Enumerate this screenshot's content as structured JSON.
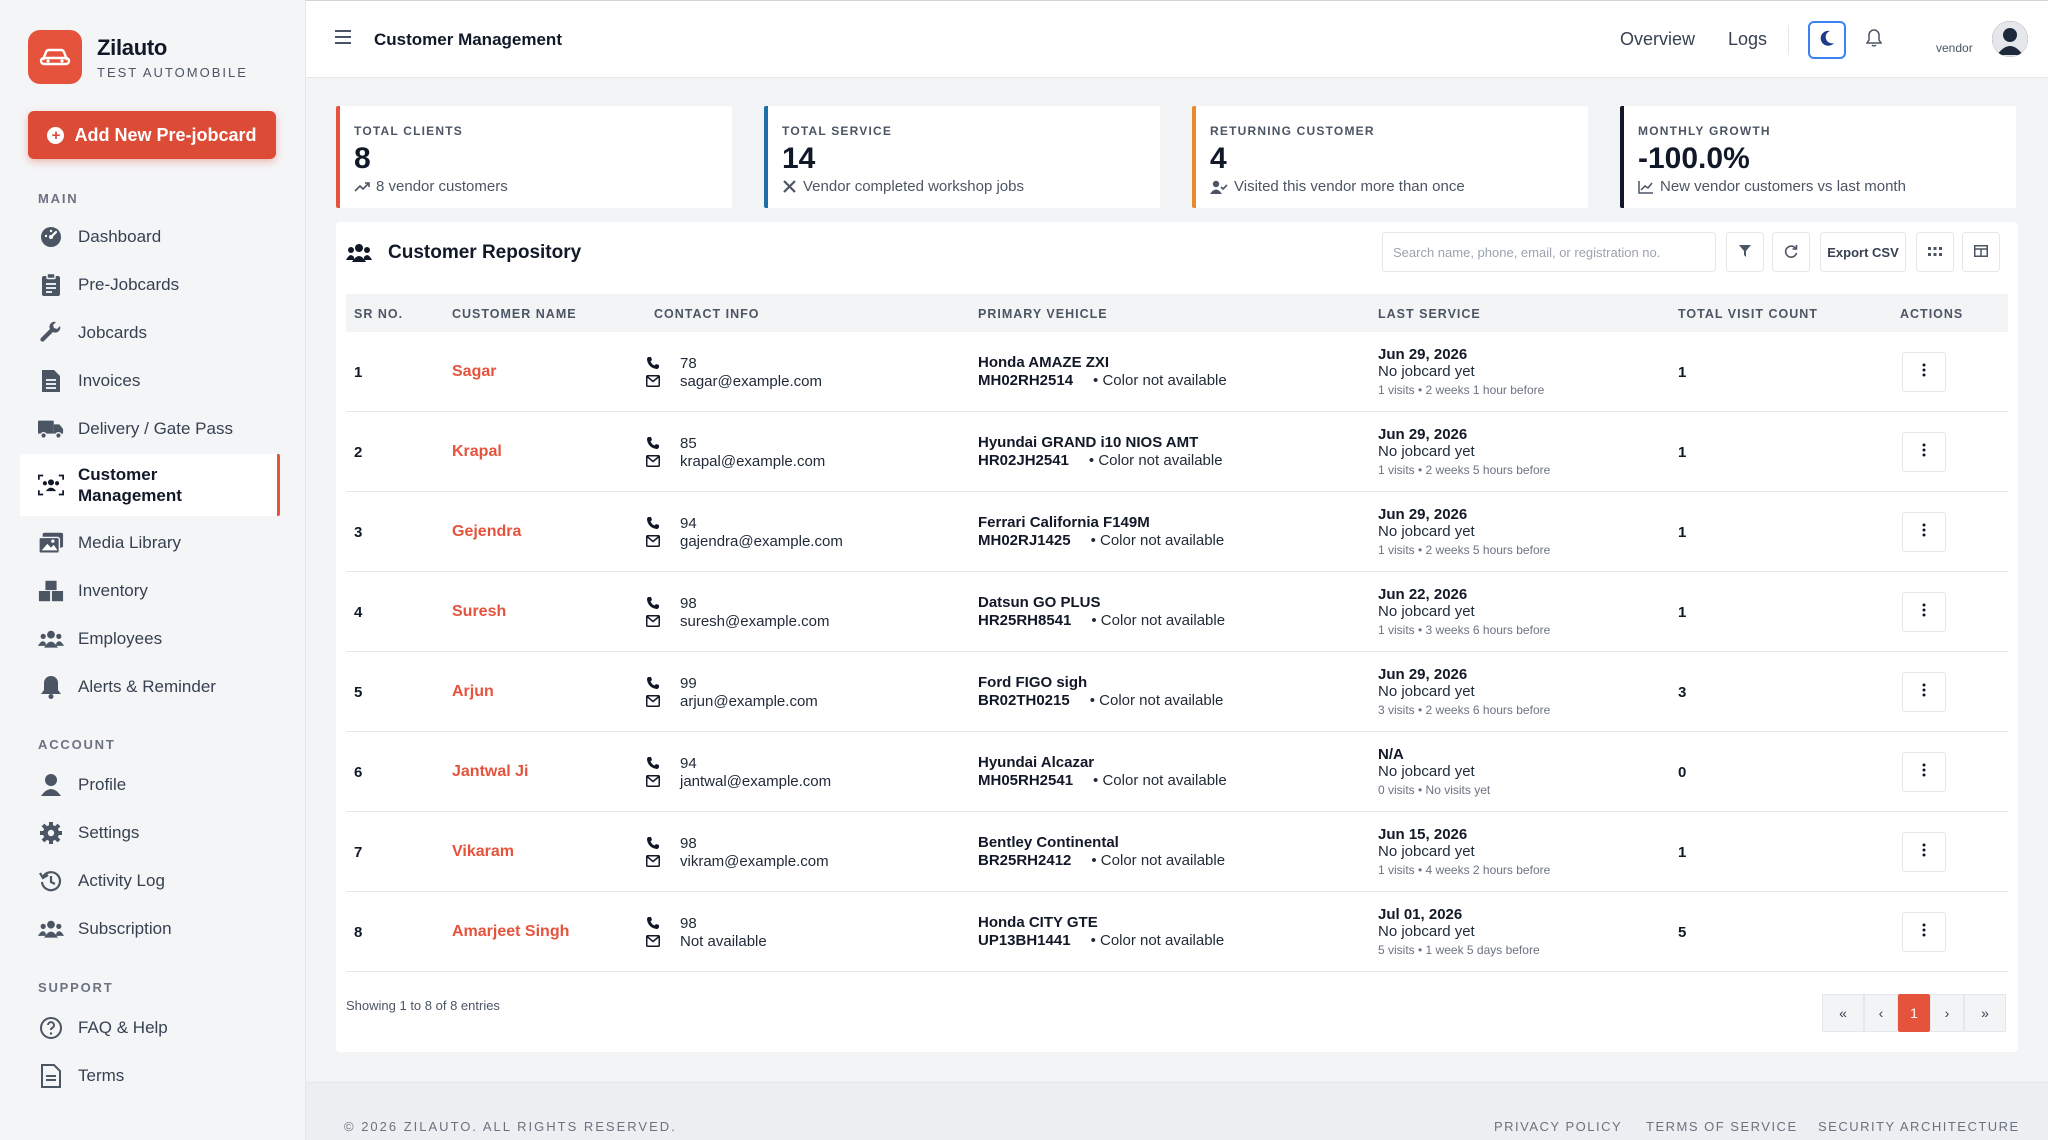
{
  "brand": {
    "name": "Zilauto",
    "subtitle": "TEST AUTOMOBILE"
  },
  "sidebar": {
    "new_button": "Add New Pre-jobcard",
    "sections": {
      "main": "MAIN",
      "account": "ACCOUNT",
      "support": "SUPPORT"
    },
    "main_items": [
      {
        "label": "Dashboard",
        "icon": "dashboard-icon"
      },
      {
        "label": "Pre-Jobcards",
        "icon": "clipboard-icon"
      },
      {
        "label": "Jobcards",
        "icon": "wrench-icon"
      },
      {
        "label": "Invoices",
        "icon": "invoice-icon"
      },
      {
        "label": "Delivery / Gate Pass",
        "icon": "truck-icon"
      },
      {
        "label": "Customer Management",
        "icon": "customers-icon",
        "active": true
      },
      {
        "label": "Media Library",
        "icon": "media-icon"
      },
      {
        "label": "Inventory",
        "icon": "boxes-icon"
      },
      {
        "label": "Employees",
        "icon": "users-icon"
      },
      {
        "label": "Alerts & Reminder",
        "icon": "bell-icon"
      }
    ],
    "account_items": [
      {
        "label": "Profile",
        "icon": "user-icon"
      },
      {
        "label": "Settings",
        "icon": "gear-icon"
      },
      {
        "label": "Activity Log",
        "icon": "history-icon"
      },
      {
        "label": "Subscription",
        "icon": "group-icon"
      }
    ],
    "support_items": [
      {
        "label": "FAQ & Help",
        "icon": "help-icon"
      },
      {
        "label": "Terms",
        "icon": "document-icon"
      }
    ]
  },
  "header": {
    "title": "Customer Management",
    "links": [
      "Overview",
      "Logs"
    ],
    "user_label": "vendor"
  },
  "stats": [
    {
      "label": "TOTAL CLIENTS",
      "value": "8",
      "sub": "8 vendor customers",
      "color": "#e5533d",
      "icon": "trend-up-icon"
    },
    {
      "label": "TOTAL SERVICE",
      "value": "14",
      "sub": "Vendor completed workshop jobs",
      "color": "#1e6fa8",
      "icon": "tools-icon"
    },
    {
      "label": "RETURNING CUSTOMER",
      "value": "4",
      "sub": "Visited this vendor more than once",
      "color": "#ea8a2e",
      "icon": "user-check-icon"
    },
    {
      "label": "MONTHLY GROWTH",
      "value": "-100.0%",
      "sub": "New vendor customers vs last month",
      "color": "#111827",
      "icon": "chart-icon"
    }
  ],
  "repository": {
    "title": "Customer Repository",
    "search_placeholder": "Search name, phone, email, or registration no.",
    "export_label": "Export CSV",
    "columns": [
      "SR NO.",
      "CUSTOMER NAME",
      "CONTACT INFO",
      "PRIMARY VEHICLE",
      "LAST SERVICE",
      "TOTAL VISIT COUNT",
      "ACTIONS"
    ],
    "rows": [
      {
        "sr": "1",
        "name": "Sagar",
        "phone": "78",
        "email": "sagar@example.com",
        "vehicle": "Honda AMAZE ZXI",
        "reg": "MH02RH2514",
        "color": "• Color not available",
        "date": "Jun 29, 2026",
        "note": "No jobcard yet",
        "meta": "1 visits • 2 weeks 1 hour before",
        "visits": "1"
      },
      {
        "sr": "2",
        "name": "Krapal",
        "phone": "85",
        "email": "krapal@example.com",
        "vehicle": "Hyundai GRAND i10 NIOS AMT",
        "reg": "HR02JH2541",
        "color": "• Color not available",
        "date": "Jun 29, 2026",
        "note": "No jobcard yet",
        "meta": "1 visits • 2 weeks 5 hours before",
        "visits": "1"
      },
      {
        "sr": "3",
        "name": "Gejendra",
        "phone": "94",
        "email": "gajendra@example.com",
        "vehicle": "Ferrari California F149M",
        "reg": "MH02RJ1425",
        "color": "• Color not available",
        "date": "Jun 29, 2026",
        "note": "No jobcard yet",
        "meta": "1 visits • 2 weeks 5 hours before",
        "visits": "1"
      },
      {
        "sr": "4",
        "name": "Suresh",
        "phone": "98",
        "email": "suresh@example.com",
        "vehicle": "Datsun GO PLUS",
        "reg": "HR25RH8541",
        "color": "• Color not available",
        "date": "Jun 22, 2026",
        "note": "No jobcard yet",
        "meta": "1 visits • 3 weeks 6 hours before",
        "visits": "1"
      },
      {
        "sr": "5",
        "name": "Arjun",
        "phone": "99",
        "email": "arjun@example.com",
        "vehicle": "Ford FIGO sigh",
        "reg": "BR02TH0215",
        "color": "• Color not available",
        "date": "Jun 29, 2026",
        "note": "No jobcard yet",
        "meta": "3 visits • 2 weeks 6 hours before",
        "visits": "3"
      },
      {
        "sr": "6",
        "name": "Jantwal Ji",
        "phone": "94",
        "email": "jantwal@example.com",
        "vehicle": "Hyundai Alcazar",
        "reg": "MH05RH2541",
        "color": "• Color not available",
        "date": "N/A",
        "note": "No jobcard yet",
        "meta": "0 visits • No visits yet",
        "visits": "0"
      },
      {
        "sr": "7",
        "name": "Vikaram",
        "phone": "98",
        "email": "vikram@example.com",
        "vehicle": "Bentley Continental",
        "reg": "BR25RH2412",
        "color": "• Color not available",
        "date": "Jun 15, 2026",
        "note": "No jobcard yet",
        "meta": "1 visits • 4 weeks 2 hours before",
        "visits": "1"
      },
      {
        "sr": "8",
        "name": "Amarjeet Singh",
        "phone": "98",
        "email": "Not available",
        "vehicle": "Honda CITY GTE",
        "reg": "UP13BH1441",
        "color": "• Color not available",
        "date": "Jul 01, 2026",
        "note": "No jobcard yet",
        "meta": "5 visits • 1 week 5 days before",
        "visits": "5"
      }
    ],
    "entries_text": "Showing 1 to 8 of 8 entries",
    "current_page": "1"
  },
  "footer": {
    "copyright": "© 2026 ZILAUTO. ALL RIGHTS RESERVED.",
    "links": [
      "PRIVACY POLICY",
      "TERMS OF SERVICE",
      "SECURITY ARCHITECTURE"
    ]
  },
  "colors": {
    "accent": "#e5533d",
    "highlight": "#3b82f6"
  }
}
